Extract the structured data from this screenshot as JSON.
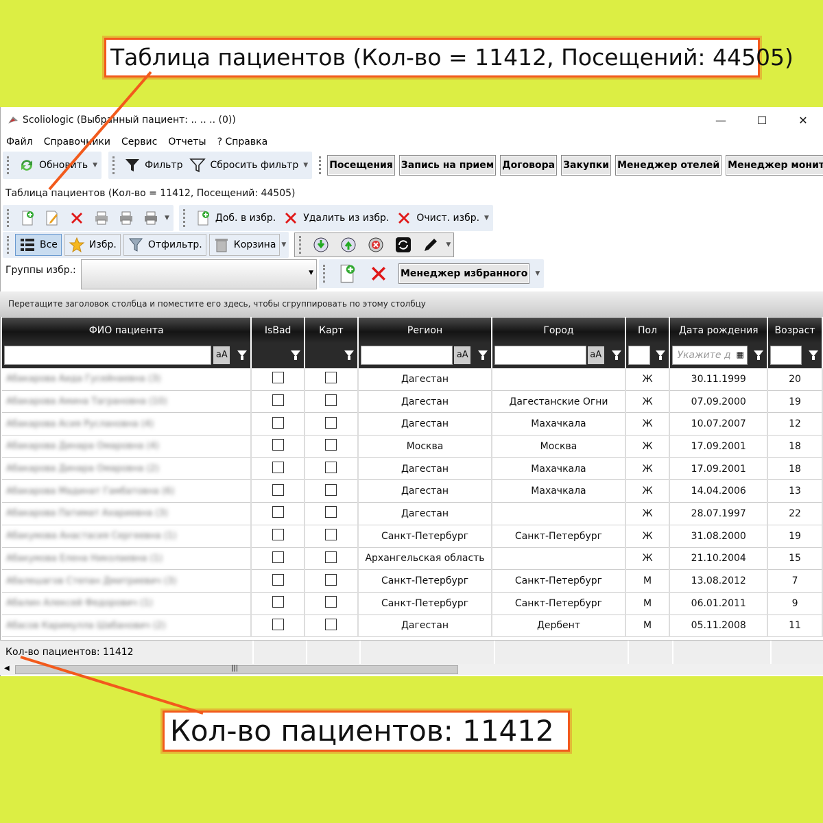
{
  "callouts": {
    "top": "Таблица пациентов (Кол-во = 11412, Посещений: 44505)",
    "bottom": "Кол-во пациентов: 11412"
  },
  "window": {
    "title": "Scoliologic (Выбранный пациент: .. .. .. (0))",
    "minimize": "—",
    "maximize": "☐",
    "close": "✕"
  },
  "menu": [
    "Файл",
    "Справочники",
    "Сервис",
    "Отчеты",
    "? Справка"
  ],
  "toolbar1": {
    "refresh": "Обновить",
    "filter": "Фильтр",
    "reset_filter": "Сбросить фильтр",
    "buttons": [
      "Посещения",
      "Запись на прием",
      "Договора",
      "Закупки",
      "Менеджер отелей",
      "Менеджер мониторов"
    ]
  },
  "table_title": "Таблица пациентов (Кол-во = 11412, Посещений: 44505)",
  "toolbar2": {
    "add_fav": "Доб. в избр.",
    "remove_fav": "Удалить из избр.",
    "clear_fav": "Очист. избр."
  },
  "toolbar3": {
    "all": "Все",
    "fav": "Избр.",
    "filtered": "Отфильтр.",
    "trash": "Корзина"
  },
  "groups": {
    "label": "Группы избр.:",
    "manager": "Менеджер избранного"
  },
  "group_hint": "Перетащите заголовок столбца и поместите его здесь, чтобы сгруппировать по этому столбцу",
  "columns": [
    "ФИО пациента",
    "IsBad",
    "Карт",
    "Регион",
    "Город",
    "Пол",
    "Дата рождения",
    "Возраст"
  ],
  "date_placeholder": "Укажите д",
  "aa": "aA",
  "rows": [
    {
      "fio": "Абакарова Аида Гусейнаевна (3)",
      "region": "Дагестан",
      "city": "",
      "sex": "Ж",
      "dob": "30.11.1999",
      "age": "20"
    },
    {
      "fio": "Абакарова Амина Таграновна (10)",
      "region": "Дагестан",
      "city": "Дагестанские Огни",
      "sex": "Ж",
      "dob": "07.09.2000",
      "age": "19"
    },
    {
      "fio": "Абакарова Асия Руслановна (4)",
      "region": "Дагестан",
      "city": "Махачкала",
      "sex": "Ж",
      "dob": "10.07.2007",
      "age": "12"
    },
    {
      "fio": "Абакарова Динара Омаровна (4)",
      "region": "Москва",
      "city": "Москва",
      "sex": "Ж",
      "dob": "17.09.2001",
      "age": "18"
    },
    {
      "fio": "Абакарова Динара Омаровна (2)",
      "region": "Дагестан",
      "city": "Махачкала",
      "sex": "Ж",
      "dob": "17.09.2001",
      "age": "18"
    },
    {
      "fio": "Абакарова Мадинат Гамбатовна (6)",
      "region": "Дагестан",
      "city": "Махачкала",
      "sex": "Ж",
      "dob": "14.04.2006",
      "age": "13"
    },
    {
      "fio": "Абакарова Патимат Ахариевна (3)",
      "region": "Дагестан",
      "city": "",
      "sex": "Ж",
      "dob": "28.07.1997",
      "age": "22"
    },
    {
      "fio": "Абакумова Анастасия Сергеевна (1)",
      "region": "Санкт-Петербург",
      "city": "Санкт-Петербург",
      "sex": "Ж",
      "dob": "31.08.2000",
      "age": "19"
    },
    {
      "fio": "Абакумова Елена Николаевна (1)",
      "region": "Архангельская область",
      "city": "",
      "sex": "Ж",
      "dob": "21.10.2004",
      "age": "15"
    },
    {
      "fio": "Абалешагов Степан Дмитриевич (3)",
      "region": "Санкт-Петербург",
      "city": "Санкт-Петербург",
      "sex": "М",
      "dob": "13.08.2012",
      "age": "7"
    },
    {
      "fio": "Абалин Алексей Федорович (1)",
      "region": "Санкт-Петербург",
      "city": "Санкт-Петербург",
      "sex": "М",
      "dob": "06.01.2011",
      "age": "9"
    },
    {
      "fio": "Абасов Каримулла Шабанович (2)",
      "region": "Дагестан",
      "city": "Дербент",
      "sex": "М",
      "dob": "05.11.2008",
      "age": "11"
    }
  ],
  "footer": "Кол-во пациентов: 11412"
}
